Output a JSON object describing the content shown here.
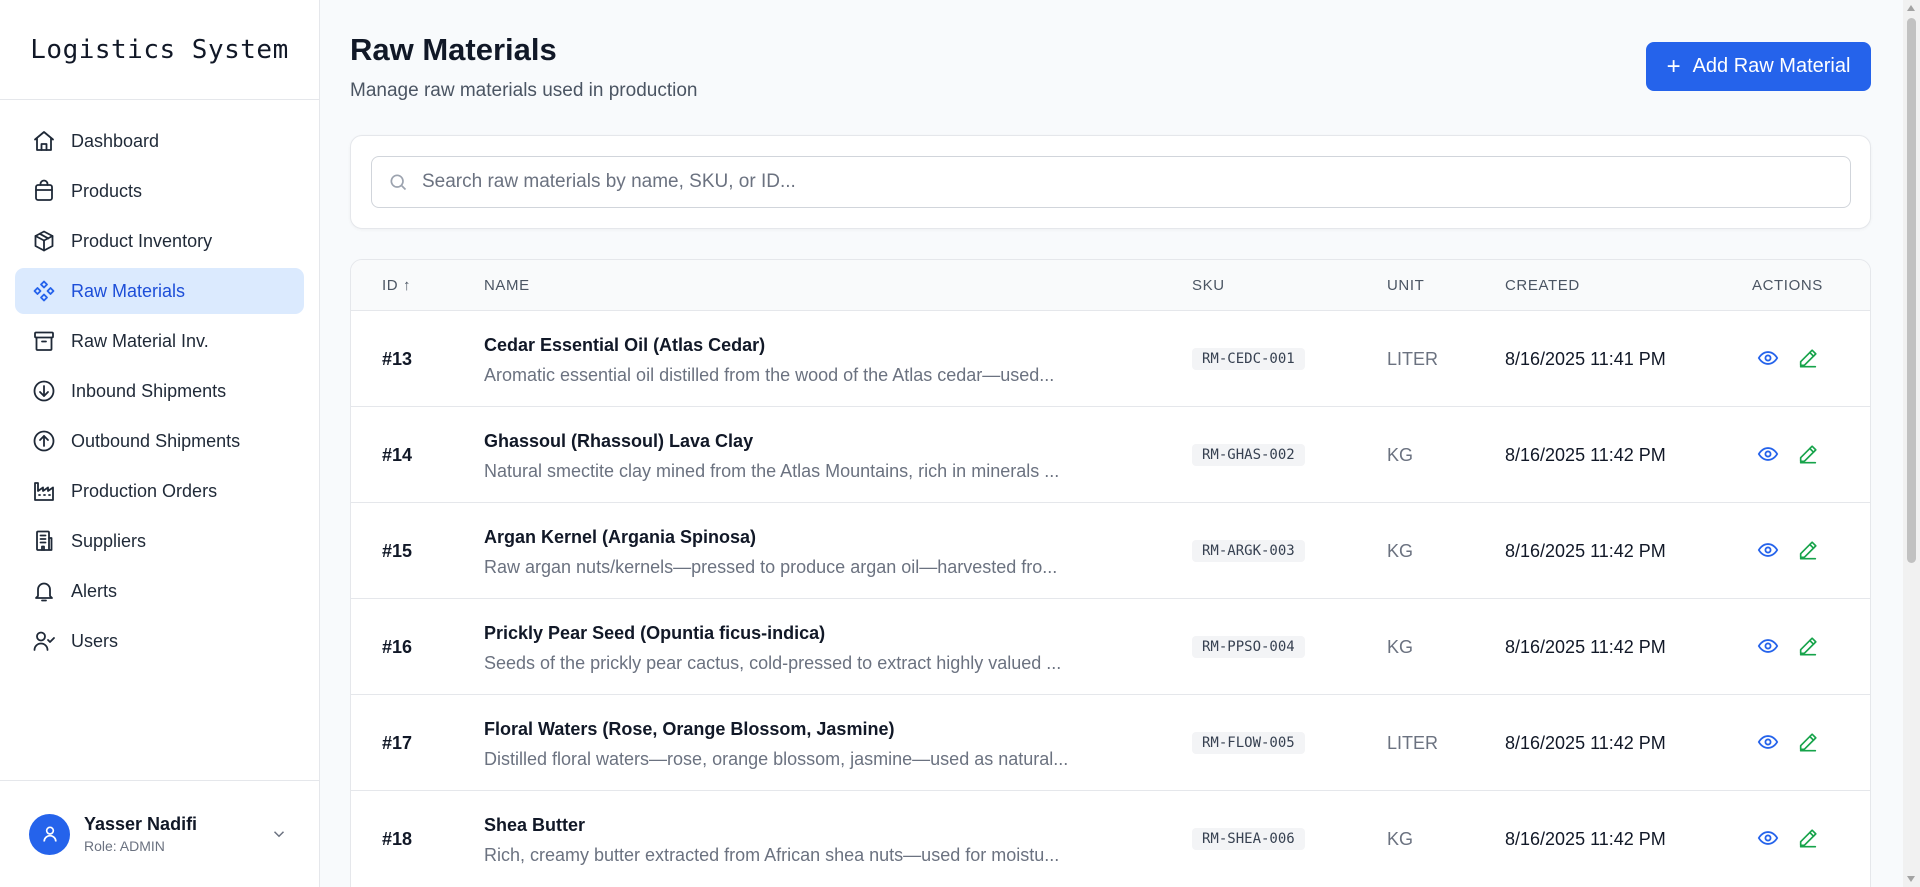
{
  "app": {
    "title": "Logistics System"
  },
  "sidebar": {
    "items": [
      {
        "label": "Dashboard",
        "icon": "home-icon",
        "active": false
      },
      {
        "label": "Products",
        "icon": "shopping-bag-icon",
        "active": false
      },
      {
        "label": "Product Inventory",
        "icon": "package-icon",
        "active": false
      },
      {
        "label": "Raw Materials",
        "icon": "components-icon",
        "active": true
      },
      {
        "label": "Raw Material Inv.",
        "icon": "archive-icon",
        "active": false
      },
      {
        "label": "Inbound Shipments",
        "icon": "arrow-down-circle-icon",
        "active": false
      },
      {
        "label": "Outbound Shipments",
        "icon": "arrow-up-circle-icon",
        "active": false
      },
      {
        "label": "Production Orders",
        "icon": "factory-icon",
        "active": false
      },
      {
        "label": "Suppliers",
        "icon": "building-icon",
        "active": false
      },
      {
        "label": "Alerts",
        "icon": "bell-icon",
        "active": false
      },
      {
        "label": "Users",
        "icon": "user-check-icon",
        "active": false
      }
    ]
  },
  "user": {
    "name": "Yasser Nadifi",
    "role": "Role: ADMIN"
  },
  "header": {
    "title": "Raw Materials",
    "subtitle": "Manage raw materials used in production",
    "add_button": "Add Raw Material"
  },
  "search": {
    "placeholder": "Search raw materials by name, SKU, or ID...",
    "value": ""
  },
  "table": {
    "columns": {
      "id": "ID ↑",
      "name": "NAME",
      "sku": "SKU",
      "unit": "UNIT",
      "created": "CREATED",
      "actions": "ACTIONS"
    },
    "rows": [
      {
        "id": "#13",
        "name": "Cedar Essential Oil (Atlas Cedar)",
        "description": "Aromatic essential oil distilled from the wood of the Atlas cedar—used...",
        "sku": "RM-CEDC-001",
        "unit": "LITER",
        "created": "8/16/2025 11:41 PM"
      },
      {
        "id": "#14",
        "name": "Ghassoul (Rhassoul) Lava Clay",
        "description": "Natural smectite clay mined from the Atlas Mountains, rich in minerals ...",
        "sku": "RM-GHAS-002",
        "unit": "KG",
        "created": "8/16/2025 11:42 PM"
      },
      {
        "id": "#15",
        "name": "Argan Kernel (Argania Spinosa)",
        "description": "Raw argan nuts/kernels—pressed to produce argan oil—harvested fro...",
        "sku": "RM-ARGK-003",
        "unit": "KG",
        "created": "8/16/2025 11:42 PM"
      },
      {
        "id": "#16",
        "name": "Prickly Pear Seed (Opuntia ficus-indica)",
        "description": "Seeds of the prickly pear cactus, cold-pressed to extract highly valued ...",
        "sku": "RM-PPSO-004",
        "unit": "KG",
        "created": "8/16/2025 11:42 PM"
      },
      {
        "id": "#17",
        "name": "Floral Waters (Rose, Orange Blossom, Jasmine)",
        "description": "Distilled floral waters—rose, orange blossom, jasmine—used as natural...",
        "sku": "RM-FLOW-005",
        "unit": "LITER",
        "created": "8/16/2025 11:42 PM"
      },
      {
        "id": "#18",
        "name": "Shea Butter",
        "description": "Rich, creamy butter extracted from African shea nuts—used for moistu...",
        "sku": "RM-SHEA-006",
        "unit": "KG",
        "created": "8/16/2025 11:42 PM"
      }
    ]
  },
  "colors": {
    "accent": "#2563eb",
    "active_bg": "#dbeafe",
    "edit": "#16a34a"
  }
}
